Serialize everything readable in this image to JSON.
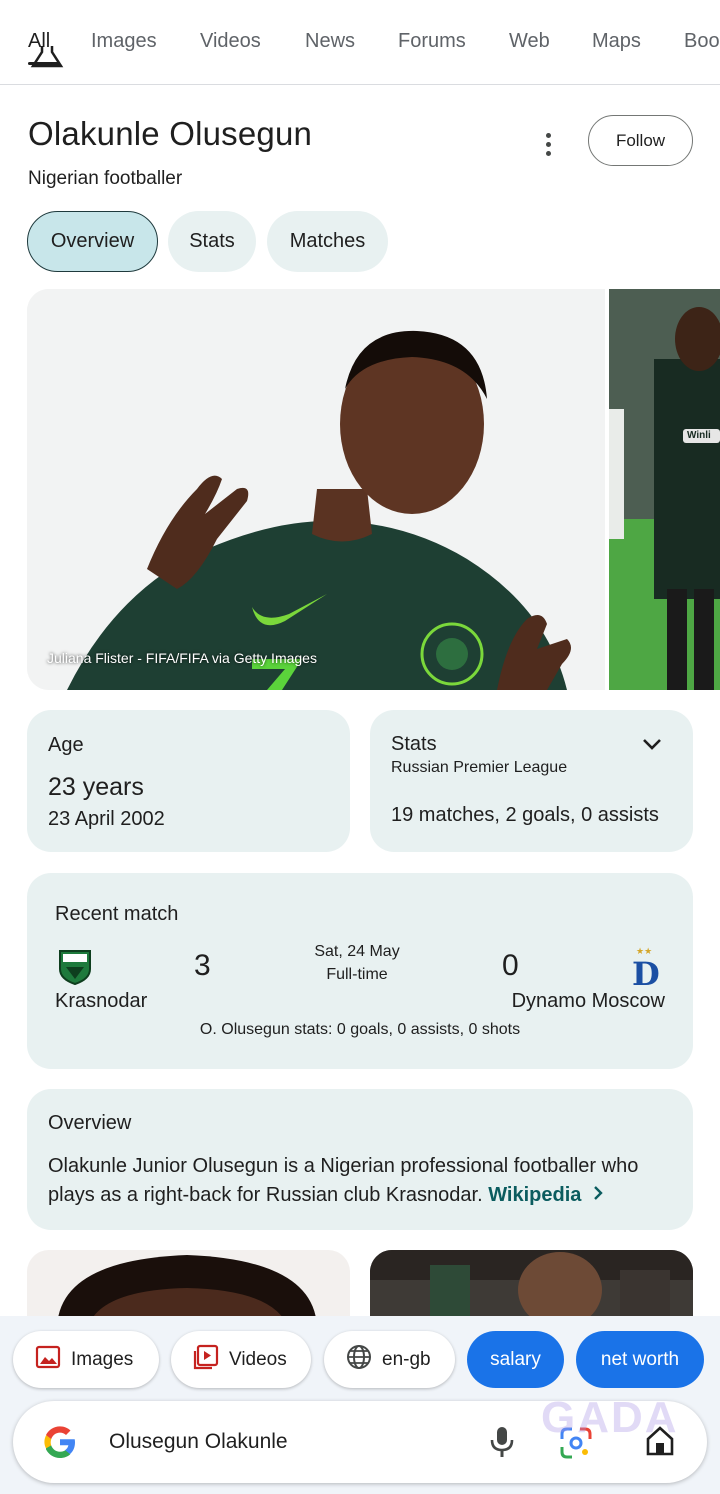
{
  "tabs": [
    {
      "label": "All"
    },
    {
      "label": "Images"
    },
    {
      "label": "Videos"
    },
    {
      "label": "News"
    },
    {
      "label": "Forums"
    },
    {
      "label": "Web"
    },
    {
      "label": "Maps"
    },
    {
      "label": "Boo"
    }
  ],
  "header": {
    "title": "Olakunle Olusegun",
    "subtitle": "Nigerian footballer",
    "follow_label": "Follow"
  },
  "chips": [
    "Overview",
    "Stats",
    "Matches"
  ],
  "image": {
    "credit": "Juliana Flister - FIFA/FIFA via Getty Images",
    "side_text": "Winli"
  },
  "age": {
    "label": "Age",
    "value": "23 years",
    "dob": "23 April 2002"
  },
  "stats": {
    "label": "Stats",
    "league": "Russian Premier League",
    "summary": "19 matches, 2 goals, 0 assists"
  },
  "recent_match": {
    "label": "Recent match",
    "home_team": "Krasnodar",
    "home_score": "3",
    "away_team": "Dynamo Moscow",
    "away_score": "0",
    "date": "Sat, 24 May",
    "status": "Full-time",
    "player_stats": "O. Olusegun stats: 0 goals, 0 assists, 0 shots"
  },
  "overview": {
    "label": "Overview",
    "text": "Olakunle Junior Olusegun is a Nigerian professional footballer who plays as a right-back for Russian club Krasnodar.",
    "source": "Wikipedia"
  },
  "bottom_chips": {
    "images": "Images",
    "videos": "Videos",
    "language": "en-gb",
    "salary": "salary",
    "net_worth": "net worth"
  },
  "search": {
    "query": "Olusegun Olakunle",
    "watermark": "GADA"
  },
  "colors": {
    "accent_blue": "#1a73e8",
    "card_bg": "#e8f1f1",
    "link": "#0b5c5f"
  }
}
